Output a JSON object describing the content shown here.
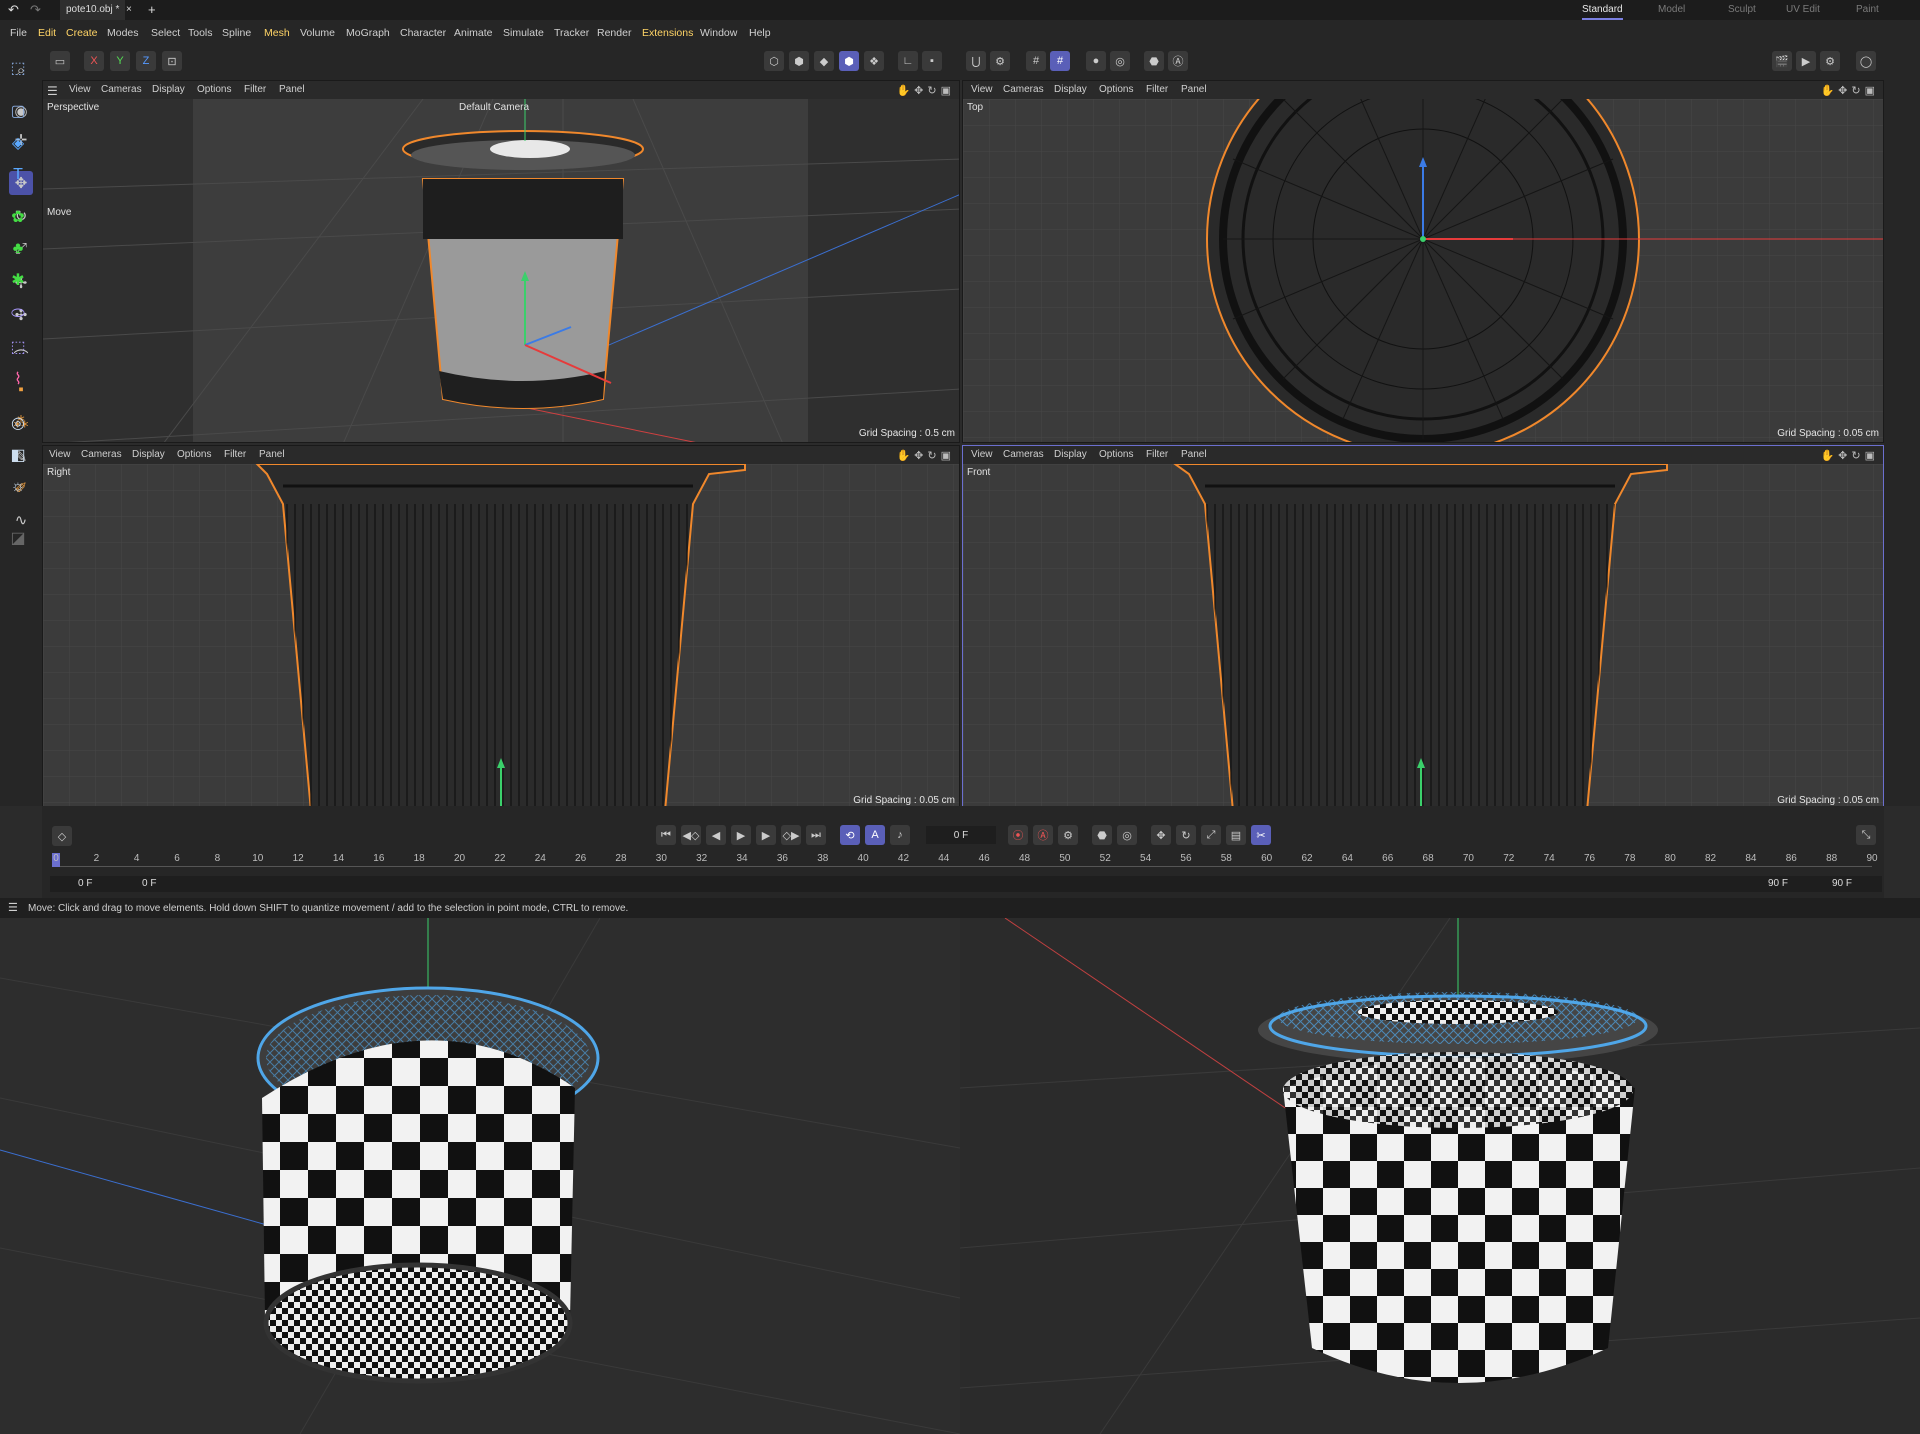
{
  "tabbar": {
    "file_tab": "pote10.obj *",
    "close": "×",
    "add": "+",
    "layouts": [
      "Standard",
      "Model",
      "Sculpt",
      "UV Edit",
      "Paint"
    ]
  },
  "menu": [
    "File",
    "Edit",
    "Create",
    "Modes",
    "Select",
    "Tools",
    "Spline",
    "Mesh",
    "Volume",
    "MoGraph",
    "Character",
    "Animate",
    "Simulate",
    "Tracker",
    "Render",
    "Extensions",
    "Window",
    "Help"
  ],
  "menu_highlight": [
    "Edit",
    "Create",
    "Mesh",
    "Extensions"
  ],
  "axes_lock": [
    "X",
    "Y",
    "Z"
  ],
  "viewport_menu": [
    "View",
    "Cameras",
    "Display",
    "Options",
    "Filter",
    "Panel"
  ],
  "viewports": {
    "perspective": {
      "name": "Perspective",
      "camera": "Default Camera",
      "tool_label": "Move",
      "grid": "Grid Spacing : 0.5 cm"
    },
    "top": {
      "name": "Top",
      "grid": "Grid Spacing : 0.05 cm"
    },
    "right": {
      "name": "Right",
      "grid": "Grid Spacing : 0.05 cm"
    },
    "front": {
      "name": "Front",
      "grid": "Grid Spacing : 0.05 cm"
    }
  },
  "timeline": {
    "current_frame": "0 F",
    "ticks": [
      "0",
      "2",
      "4",
      "6",
      "8",
      "10",
      "12",
      "14",
      "16",
      "18",
      "20",
      "22",
      "24",
      "26",
      "28",
      "30",
      "32",
      "34",
      "36",
      "38",
      "40",
      "42",
      "44",
      "46",
      "48",
      "50",
      "52",
      "54",
      "56",
      "58",
      "60",
      "62",
      "64",
      "66",
      "68",
      "70",
      "72",
      "74",
      "76",
      "78",
      "80",
      "82",
      "84",
      "86",
      "88",
      "90"
    ],
    "start": "0 F",
    "start2": "0 F",
    "end": "90 F",
    "end2": "90 F"
  },
  "status": "Move: Click and drag to move elements. Hold down SHIFT to quantize movement / add to the selection in point mode, CTRL to remove.",
  "colors": {
    "accent": "#5a5fb8",
    "selection_outline": "#f0882c",
    "axis_x": "#e63b3b",
    "axis_y": "#3bd06b",
    "axis_z": "#3b7be6",
    "wire_blue": "#4fa6e8"
  }
}
